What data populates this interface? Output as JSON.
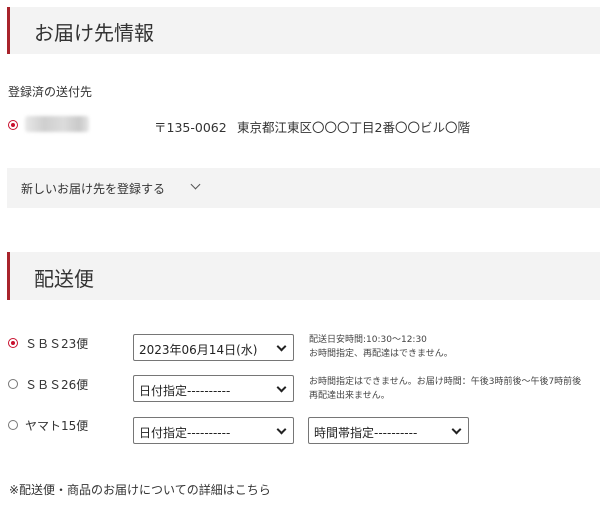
{
  "delivery_info": {
    "heading": "お届け先情報",
    "registered_label": "登録済の送付先",
    "address": {
      "postal": "〒135-0062",
      "address_text": "東京都江東区〇〇〇丁目2番〇〇ビル〇階",
      "selected": true
    },
    "new_address_label": "新しいお届け先を登録する"
  },
  "shipping": {
    "heading": "配送便",
    "options": [
      {
        "label": "ＳＢＳ23便",
        "selected": true,
        "date_value": "2023年06月14日(水)",
        "note_line1": "配送日安時間:10:30～12:30",
        "note_line2": "お時間指定、再配達はできません。"
      },
      {
        "label": "ＳＢＳ26便",
        "selected": false,
        "date_value": "日付指定----------",
        "note_line1": "お時間指定はできません。お届け時間：午後3時前後～午後7時前後",
        "note_line2": "再配達出来ません。"
      },
      {
        "label": "ヤマト15便",
        "selected": false,
        "date_value": "日付指定----------",
        "time_value": "時間帯指定----------"
      }
    ]
  },
  "footer_note": "※配送便・商品のお届けについての詳細はこちら",
  "colors": {
    "accent": "#a8232b",
    "radio_checked": "#c8102e",
    "header_bg": "#f3f3f3"
  }
}
